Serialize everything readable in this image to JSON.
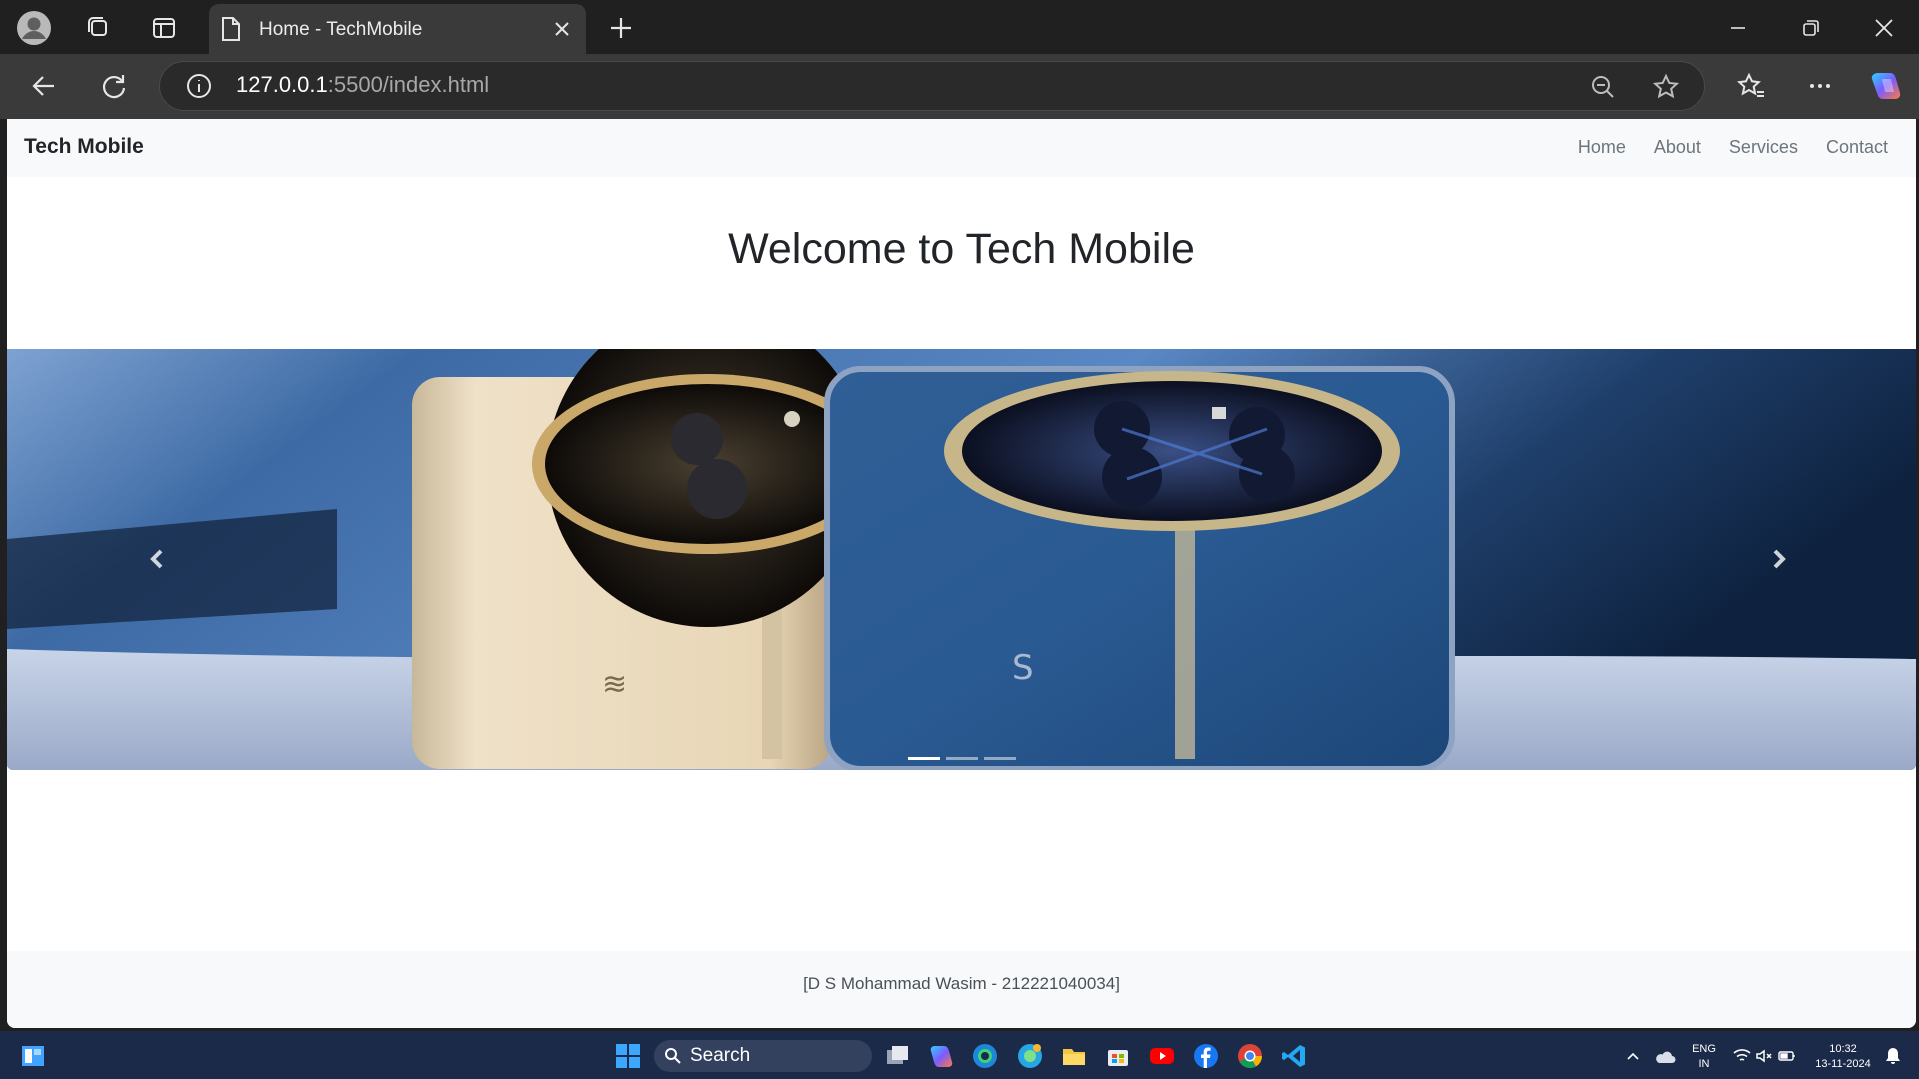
{
  "browser": {
    "tab_title": "Home - TechMobile",
    "url_host": "127.0.0.1",
    "url_rest": ":5500/index.html"
  },
  "navbar": {
    "brand": "Tech Mobile",
    "links": [
      "Home",
      "About",
      "Services",
      "Contact"
    ]
  },
  "hero": {
    "title": "Welcome to Tech Mobile"
  },
  "carousel": {
    "slide_count": 3,
    "active_index": 0
  },
  "footer": {
    "text": "[D S Mohammad Wasim - 212221040034]"
  },
  "taskbar": {
    "search_label": "Search",
    "lang_line1": "ENG",
    "lang_line2": "IN",
    "time": "10:32",
    "date": "13-11-2024"
  }
}
